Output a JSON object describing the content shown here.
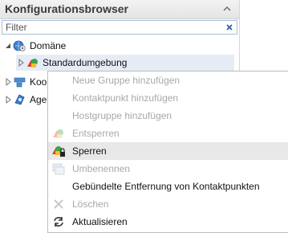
{
  "panel": {
    "title": "Konfigurationsbrowser",
    "filter_placeholder": "Filter"
  },
  "tree": {
    "root_label": "Domäne",
    "child_label": "Standardumgebung",
    "row3_label": "Koo",
    "row4_label": "Age"
  },
  "menu": {
    "items": [
      {
        "label": "Neue Gruppe hinzufügen",
        "enabled": false,
        "icon": "none"
      },
      {
        "label": "Kontaktpunkt hinzufügen",
        "enabled": false,
        "icon": "none"
      },
      {
        "label": "Hostgruppe hinzufügen",
        "enabled": false,
        "icon": "none"
      },
      {
        "label": "Entsperren",
        "enabled": false,
        "icon": "unlock-icon"
      },
      {
        "label": "Sperren",
        "enabled": true,
        "icon": "lock-icon"
      },
      {
        "label": "Umbenennen",
        "enabled": false,
        "icon": "rename-icon"
      },
      {
        "label": "Gebündelte Entfernung von Kontaktpunkten",
        "enabled": true,
        "icon": "none"
      },
      {
        "label": "Löschen",
        "enabled": false,
        "icon": "delete-icon"
      },
      {
        "label": "Aktualisieren",
        "enabled": true,
        "icon": "refresh-icon"
      }
    ]
  },
  "colors": {
    "header_bg": "#e9e9e9",
    "filter_border": "#a9c0d8",
    "disabled_text": "#a8a8a8",
    "hover_bg": "#e8e8e8"
  }
}
